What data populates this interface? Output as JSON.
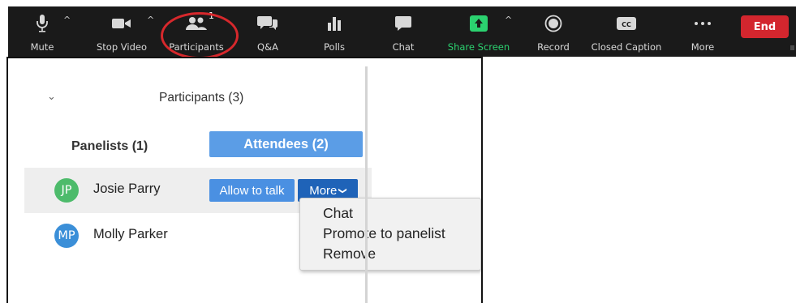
{
  "toolbar": {
    "items": [
      {
        "label": "Mute",
        "icon": "microphone-icon"
      },
      {
        "label": "Stop Video",
        "icon": "video-camera-icon"
      },
      {
        "label": "Participants",
        "icon": "participants-icon",
        "count": "1"
      },
      {
        "label": "Q&A",
        "icon": "qa-bubbles-icon"
      },
      {
        "label": "Polls",
        "icon": "polls-bars-icon"
      },
      {
        "label": "Chat",
        "icon": "chat-bubble-icon"
      },
      {
        "label": "Share Screen",
        "icon": "share-screen-arrow-icon"
      },
      {
        "label": "Record",
        "icon": "record-icon"
      },
      {
        "label": "Closed Caption",
        "icon": "closed-caption-icon"
      },
      {
        "label": "More",
        "icon": "more-dots-icon"
      }
    ],
    "cc_badge": "CC",
    "end_label": "End",
    "colors": {
      "background": "#1a1a1a",
      "share_green": "#2bd16f",
      "end_red": "#d3262e",
      "highlight_red": "#d7282c"
    }
  },
  "panel": {
    "title": "Participants (3)",
    "tabs": {
      "panelists": "Panelists (1)",
      "attendees": "Attendees (2)"
    },
    "attendees": [
      {
        "initials": "JP",
        "name": "Josie Parry",
        "avatar_color": "#4dbb6b",
        "selected": true
      },
      {
        "initials": "MP",
        "name": "Molly Parker",
        "avatar_color": "#3b8fd8",
        "selected": false
      }
    ],
    "actions": {
      "allow_to_talk": "Allow to talk",
      "more": "More"
    },
    "more_menu": [
      "Chat",
      "Promote to panelist",
      "Remove"
    ],
    "colors": {
      "tab_active": "#5b9de6",
      "allow_button": "#4a90e2",
      "more_button": "#1f63b8",
      "row_selected": "#eeeeee"
    }
  }
}
